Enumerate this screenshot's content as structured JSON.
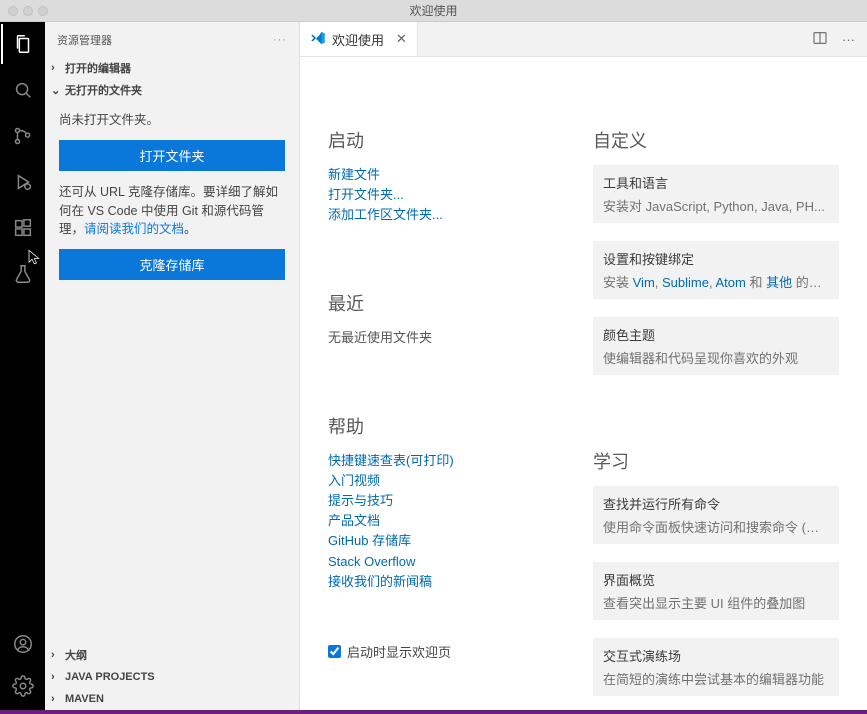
{
  "window": {
    "title": "欢迎使用"
  },
  "sidebar": {
    "title": "资源管理器",
    "sections": {
      "openEditors": "打开的编辑器",
      "noFolder": "无打开的文件夹",
      "outline": "大纲",
      "javaProjects": "JAVA PROJECTS",
      "maven": "MAVEN"
    },
    "body": {
      "noFolderMsg": "尚未打开文件夹。",
      "openFolderBtn": "打开文件夹",
      "cloneDesc1": "还可从 URL 克隆存储库。要详细了解如何在 VS Code 中使用 Git 和源代码管理，",
      "readDocsLink": "请阅读我们的文档",
      "cloneDesc2": "。",
      "cloneBtn": "克隆存储库"
    }
  },
  "tab": {
    "label": "欢迎使用"
  },
  "welcome": {
    "start": {
      "title": "启动",
      "newFile": "新建文件",
      "openFolder": "打开文件夹...",
      "addWorkspace": "添加工作区文件夹..."
    },
    "recent": {
      "title": "最近",
      "none": "无最近使用文件夹"
    },
    "help": {
      "title": "帮助",
      "cheatsheet": "快捷键速查表(可打印)",
      "introVideos": "入门视频",
      "tips": "提示与技巧",
      "docs": "产品文档",
      "github": "GitHub 存储库",
      "so": "Stack Overflow",
      "newsletter": "接收我们的新闻稿"
    },
    "showOnStartup": "启动时显示欢迎页",
    "customize": {
      "title": "自定义",
      "toolsLang": {
        "t": "工具和语言",
        "s1": "安装对 JavaScript, Python, Java, PH..."
      },
      "keys": {
        "t": "设置和按键绑定",
        "prefix": "安装 ",
        "vim": "Vim",
        "sublime": "Sublime",
        "atom": "Atom",
        "and": " 和 ",
        "other": "其他",
        "suffix": " 的设..."
      },
      "theme": {
        "t": "颜色主题",
        "s": "使编辑器和代码呈现你喜欢的外观"
      }
    },
    "learn": {
      "title": "学习",
      "commands": {
        "t": "查找并运行所有命令",
        "s": "使用命令面板快速访问和搜索命令 (⇧..."
      },
      "overview": {
        "t": "界面概览",
        "s": "查看突出显示主要 UI 组件的叠加图"
      },
      "playground": {
        "t": "交互式演练场",
        "s": "在简短的演练中尝试基本的编辑器功能"
      }
    }
  }
}
